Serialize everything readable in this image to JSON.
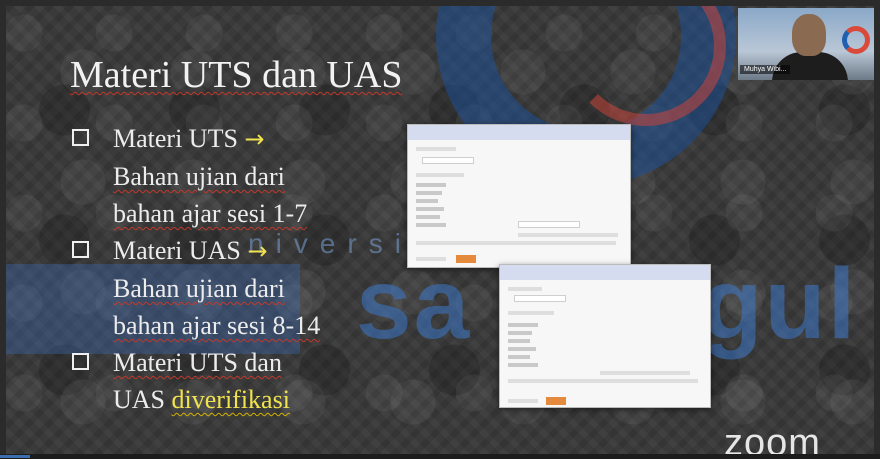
{
  "slide": {
    "title": "Materi UTS dan UAS",
    "bullets": [
      {
        "lines": [
          "Materi UTS",
          "Bahan ujian dari",
          "bahan ajar sesi 1-7"
        ],
        "arrow": "→"
      },
      {
        "lines": [
          "Materi UAS",
          "Bahan ujian dari",
          "bahan ajar sesi 8-14"
        ],
        "arrow": "→"
      },
      {
        "lines": [
          "Materi UTS dan",
          "UAS",
          "diverifikasi"
        ],
        "arrow": ""
      }
    ]
  },
  "watermark": {
    "top": "niversitas",
    "big": "sa Unggul"
  },
  "participant": {
    "name": "Muhya Wibi..."
  },
  "app": {
    "brand": "zoom"
  },
  "icons": [
    "checkbox-icon",
    "arrow-right-icon",
    "zoom-logo"
  ],
  "colors": {
    "accent_arrow": "#f1e34d",
    "form_button": "#e58a3c",
    "form_header": "#d6dcef"
  }
}
